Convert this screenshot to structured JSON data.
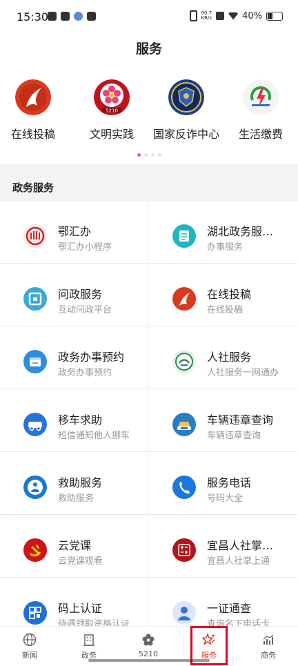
{
  "status_bar": {
    "time": "15:30",
    "net_speed_value": "90.7",
    "net_speed_unit": "KB/s",
    "battery": "40%",
    "icons": [
      "message-icon",
      "app-icon",
      "settings-icon",
      "chat-icon",
      "vibrate-icon",
      "x-icon",
      "wifi-icon",
      "battery-icon"
    ]
  },
  "page": {
    "title": "服务"
  },
  "carousel": {
    "items": [
      {
        "label": "在线投稿",
        "icon": "red-flame-logo-icon"
      },
      {
        "label": "文明实践",
        "icon": "flower-5210-badge-icon"
      },
      {
        "label": "国家反诈中心",
        "icon": "police-shield-badge-icon"
      },
      {
        "label": "生活缴费",
        "icon": "power-bolt-icon"
      }
    ],
    "pager": {
      "count": 4,
      "active_index": 0
    }
  },
  "section": {
    "title": "政务服务"
  },
  "services": [
    {
      "title": "鄂汇办",
      "subtitle": "鄂汇办小程序",
      "icon": "ehuiban-logo-icon",
      "color": "#c9252b"
    },
    {
      "title": "湖北政务服…",
      "subtitle": "办事服务",
      "icon": "document-icon",
      "color": "#1fb6c3"
    },
    {
      "title": "问政服务",
      "subtitle": "互动问政平台",
      "icon": "wen-icon",
      "color": "#3aa8d8"
    },
    {
      "title": "在线投稿",
      "subtitle": "在线投稿",
      "icon": "red-flame-logo-icon",
      "color": "#d93a1f"
    },
    {
      "title": "政务办事预约",
      "subtitle": "政务办事预约",
      "icon": "calendar-icon",
      "color": "#2f8de0"
    },
    {
      "title": "人社服务",
      "subtitle": "人社服务一网通办",
      "icon": "renshe-logo-icon",
      "color": "#2c8a4a"
    },
    {
      "title": "移车求助",
      "subtitle": "短信通知他人挪车",
      "icon": "car-move-icon",
      "color": "#2673d9"
    },
    {
      "title": "车辆违章查询",
      "subtitle": "车辆违章查询",
      "icon": "car-violation-icon",
      "color": "#2a7cc4"
    },
    {
      "title": "救助服务",
      "subtitle": "救助服务",
      "icon": "rescue-icon",
      "color": "#1b78d1"
    },
    {
      "title": "服务电话",
      "subtitle": "号码大全",
      "icon": "phone-icon",
      "color": "#1a78e0"
    },
    {
      "title": "云党课",
      "subtitle": "云党课观看",
      "icon": "party-emblem-icon",
      "color": "#d0121b"
    },
    {
      "title": "宜昌人社掌…",
      "subtitle": "宜昌人社掌上通",
      "icon": "yichang-seal-icon",
      "color": "#b3141b"
    },
    {
      "title": "码上认证",
      "subtitle": "待遇领取资格认证",
      "icon": "qr-code-icon",
      "color": "#1f6fd9"
    },
    {
      "title": "一证通查",
      "subtitle": "查询名下电话卡",
      "icon": "id-check-icon",
      "color": "#3b6fd4"
    }
  ],
  "tabbar": {
    "active_index": 3,
    "tabs": [
      {
        "label": "新闻",
        "icon": "globe-icon"
      },
      {
        "label": "政务",
        "icon": "building-icon"
      },
      {
        "label": "5210",
        "icon": "flower-icon"
      },
      {
        "label": "服务",
        "icon": "star-service-icon"
      },
      {
        "label": "商务",
        "icon": "chart-icon"
      }
    ]
  },
  "colors": {
    "accent": "#d63a2b",
    "highlight_box": "#e0001b",
    "pager_active": "#e0664f"
  }
}
